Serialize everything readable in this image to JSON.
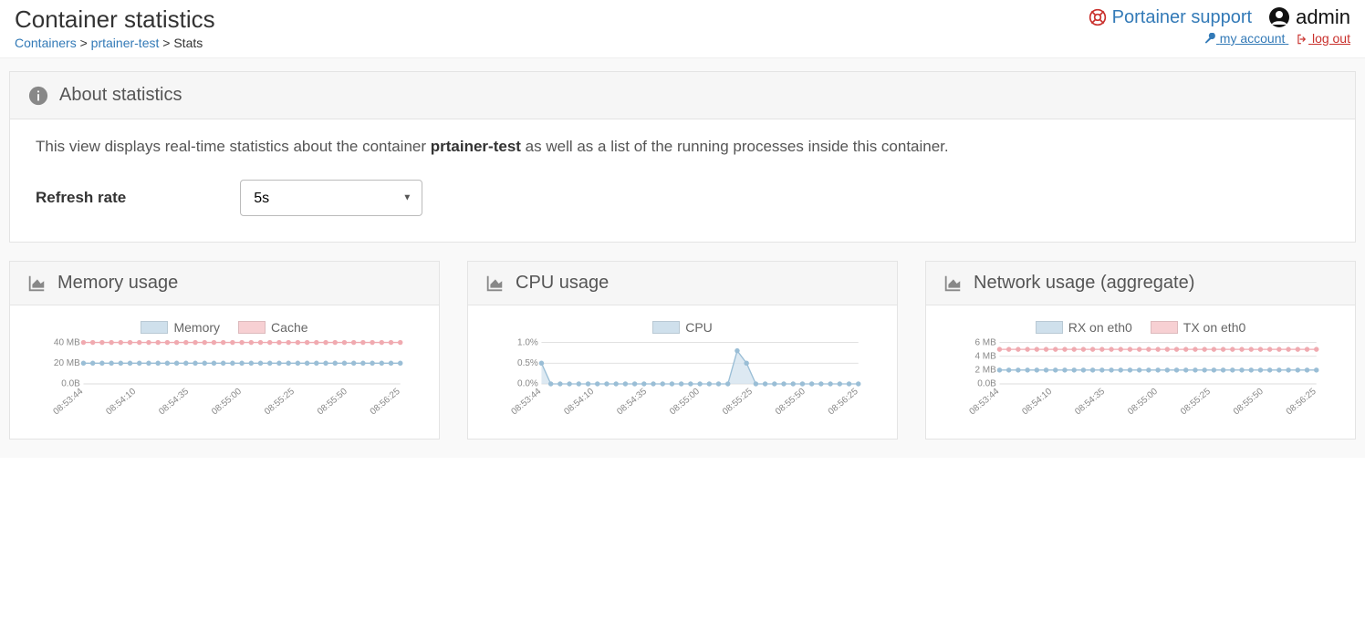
{
  "header": {
    "title": "Container statistics",
    "breadcrumb": {
      "containers": "Containers",
      "container_name": "prtainer-test",
      "current": "Stats"
    },
    "support_link": "Portainer support",
    "user": "admin",
    "my_account": "my account",
    "logout": "log out"
  },
  "about_panel": {
    "heading": "About statistics",
    "body_prefix": "This view displays real-time statistics about the container ",
    "container_name": "prtainer-test",
    "body_suffix": " as well as a list of the running processes inside this container.",
    "refresh_label": "Refresh rate",
    "refresh_value": "5s"
  },
  "chart_data": [
    {
      "title": "Memory usage",
      "type": "line",
      "x_labels": [
        "08:53:44",
        "08:54:10",
        "08:54:35",
        "08:55:00",
        "08:55:25",
        "08:55:50",
        "08:56:25"
      ],
      "y_ticks": [
        "0.0B",
        "20 MB",
        "40 MB"
      ],
      "ylim": [
        0,
        40
      ],
      "series": [
        {
          "name": "Memory",
          "color": "blue",
          "values": [
            20,
            20,
            20,
            20,
            20,
            20,
            20,
            20,
            20,
            20,
            20,
            20,
            20,
            20,
            20,
            20,
            20,
            20,
            20,
            20,
            20,
            20,
            20,
            20,
            20,
            20,
            20,
            20,
            20,
            20,
            20,
            20,
            20,
            20,
            20
          ]
        },
        {
          "name": "Cache",
          "color": "pink",
          "values": [
            40,
            40,
            40,
            40,
            40,
            40,
            40,
            40,
            40,
            40,
            40,
            40,
            40,
            40,
            40,
            40,
            40,
            40,
            40,
            40,
            40,
            40,
            40,
            40,
            40,
            40,
            40,
            40,
            40,
            40,
            40,
            40,
            40,
            40,
            40
          ]
        }
      ],
      "legend": [
        "Memory",
        "Cache"
      ]
    },
    {
      "title": "CPU usage",
      "type": "line",
      "x_labels": [
        "08:53:44",
        "08:54:10",
        "08:54:35",
        "08:55:00",
        "08:55:25",
        "08:55:50",
        "08:56:25"
      ],
      "y_ticks": [
        "0.0%",
        "0.5%",
        "1.0%"
      ],
      "ylim": [
        0,
        1.0
      ],
      "series": [
        {
          "name": "CPU",
          "color": "blue",
          "values": [
            0.5,
            0,
            0,
            0,
            0,
            0,
            0,
            0,
            0,
            0,
            0,
            0,
            0,
            0,
            0,
            0,
            0,
            0,
            0,
            0,
            0,
            0.8,
            0.5,
            0,
            0,
            0,
            0,
            0,
            0,
            0,
            0,
            0,
            0,
            0,
            0
          ]
        }
      ],
      "legend": [
        "CPU"
      ]
    },
    {
      "title": "Network usage (aggregate)",
      "type": "line",
      "x_labels": [
        "08:53:44",
        "08:54:10",
        "08:54:35",
        "08:55:00",
        "08:55:25",
        "08:55:50",
        "08:56:25"
      ],
      "y_ticks": [
        "0.0B",
        "2 MB",
        "4 MB",
        "6 MB"
      ],
      "ylim": [
        0,
        6
      ],
      "series": [
        {
          "name": "RX on eth0",
          "color": "blue",
          "values": [
            2,
            2,
            2,
            2,
            2,
            2,
            2,
            2,
            2,
            2,
            2,
            2,
            2,
            2,
            2,
            2,
            2,
            2,
            2,
            2,
            2,
            2,
            2,
            2,
            2,
            2,
            2,
            2,
            2,
            2,
            2,
            2,
            2,
            2,
            2
          ]
        },
        {
          "name": "TX on eth0",
          "color": "pink",
          "values": [
            5,
            5,
            5,
            5,
            5,
            5,
            5,
            5,
            5,
            5,
            5,
            5,
            5,
            5,
            5,
            5,
            5,
            5,
            5,
            5,
            5,
            5,
            5,
            5,
            5,
            5,
            5,
            5,
            5,
            5,
            5,
            5,
            5,
            5,
            5
          ]
        }
      ],
      "legend": [
        "RX on eth0",
        "TX on eth0"
      ]
    }
  ]
}
